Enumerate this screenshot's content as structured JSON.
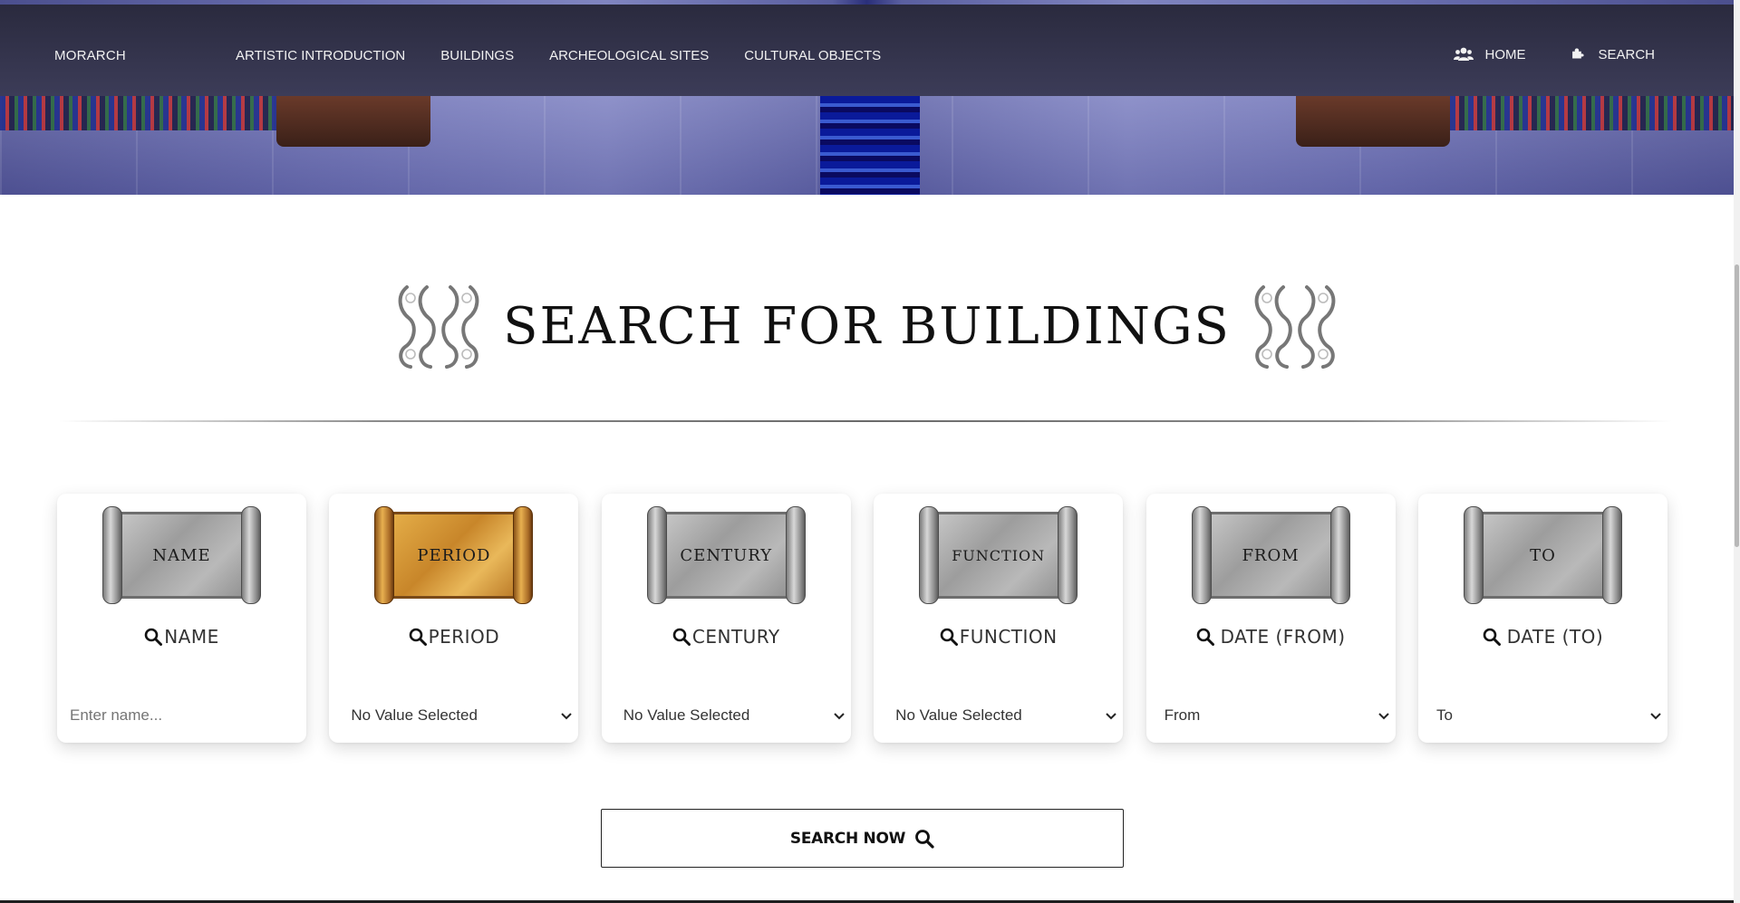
{
  "nav": {
    "brand": "MORARCH",
    "links": [
      "ARTISTIC INTRODUCTION",
      "BUILDINGS",
      "ARCHEOLOGICAL SITES",
      "CULTURAL OBJECTS"
    ],
    "home_label": "HOME",
    "search_label": "SEARCH",
    "home_icon": "users-icon",
    "search_icon": "puzzle-icon"
  },
  "page": {
    "title": "SEARCH FOR BUILDINGS",
    "ornament_icon": "baroque-scroll-ornament-icon"
  },
  "cards": [
    {
      "scroll_label": "NAME",
      "heading": "NAME",
      "control": "input",
      "placeholder": "Enter name...",
      "scroll_color": "gray"
    },
    {
      "scroll_label": "PERIOD",
      "heading": "PERIOD",
      "control": "select",
      "value": "No Value Selected",
      "scroll_color": "gold"
    },
    {
      "scroll_label": "CENTURY",
      "heading": "CENTURY",
      "control": "select",
      "value": "No Value Selected",
      "scroll_color": "gray"
    },
    {
      "scroll_label": "FUNCTION",
      "heading": "FUNCTION",
      "control": "select",
      "value": "No Value Selected",
      "scroll_color": "gray"
    },
    {
      "scroll_label": "FROM",
      "heading": "DATE (FROM)",
      "control": "select",
      "value": "From",
      "scroll_color": "gray"
    },
    {
      "scroll_label": "TO",
      "heading": "DATE (TO)",
      "control": "select",
      "value": "To",
      "scroll_color": "gray"
    }
  ],
  "search_button": {
    "label": "SEARCH NOW",
    "icon": "search-icon"
  },
  "colors": {
    "navbar": "#2a2a3e",
    "gold_scroll": "#d79a3a",
    "gray_scroll": "#a9a9a9"
  }
}
